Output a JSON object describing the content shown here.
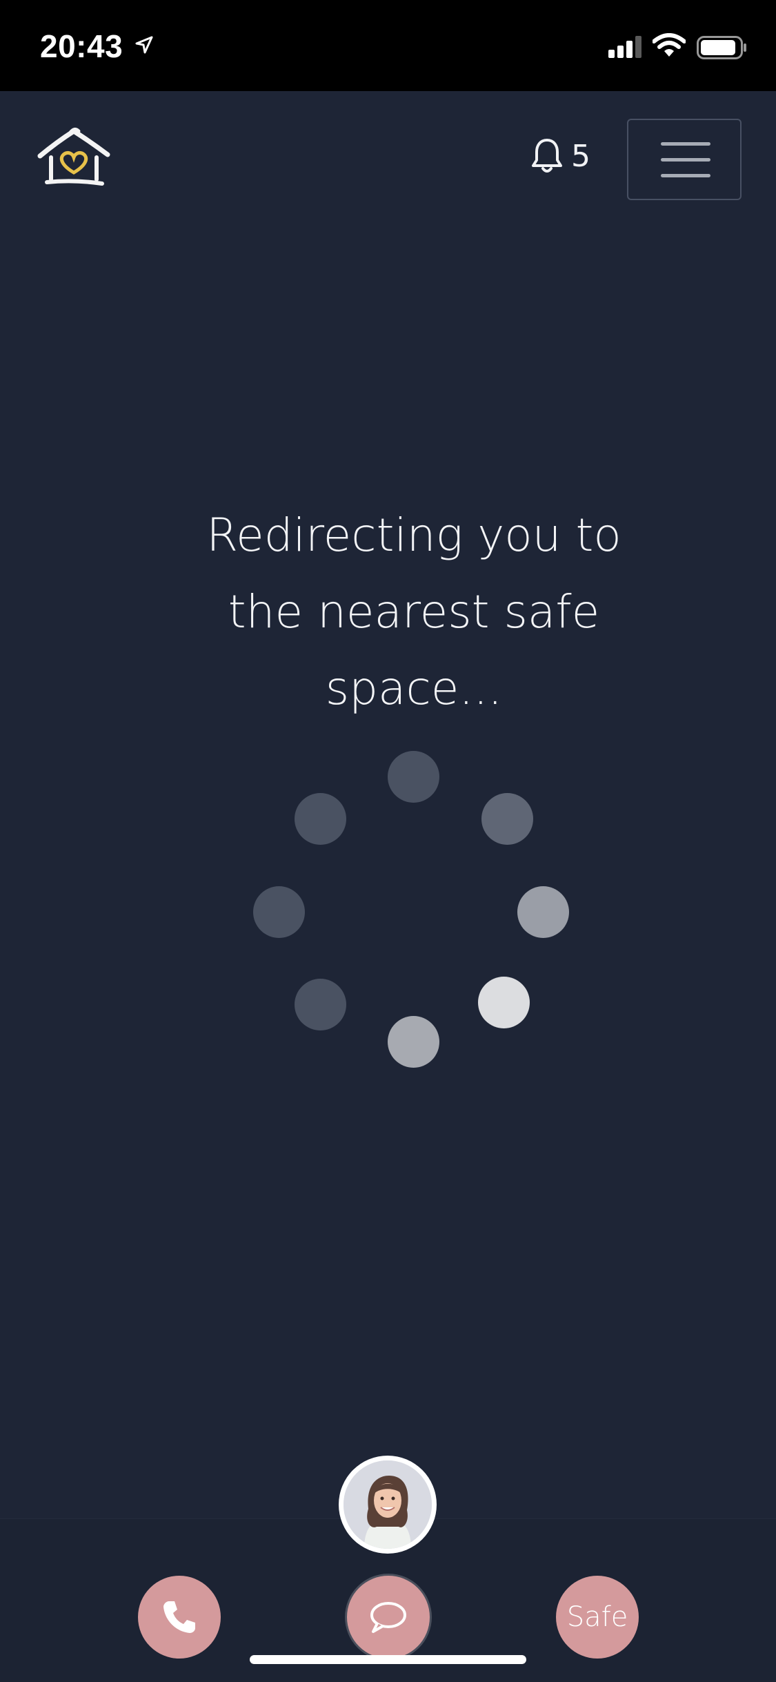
{
  "status_bar": {
    "time": "20:43"
  },
  "header": {
    "notification_count": "5"
  },
  "main": {
    "message_lines": [
      "Redirecting you to",
      "the nearest safe",
      "space..."
    ]
  },
  "bottom_nav": {
    "safe_label": "Safe"
  },
  "colors": {
    "background": "#1e2536",
    "accent_pink": "#d49a9c",
    "logo_heart": "#e7c14a"
  },
  "icons": [
    "location-arrow-icon",
    "signal-icon",
    "wifi-icon",
    "battery-icon",
    "house-heart-logo",
    "bell-icon",
    "hamburger-icon",
    "phone-icon",
    "chat-bubble-icon"
  ]
}
